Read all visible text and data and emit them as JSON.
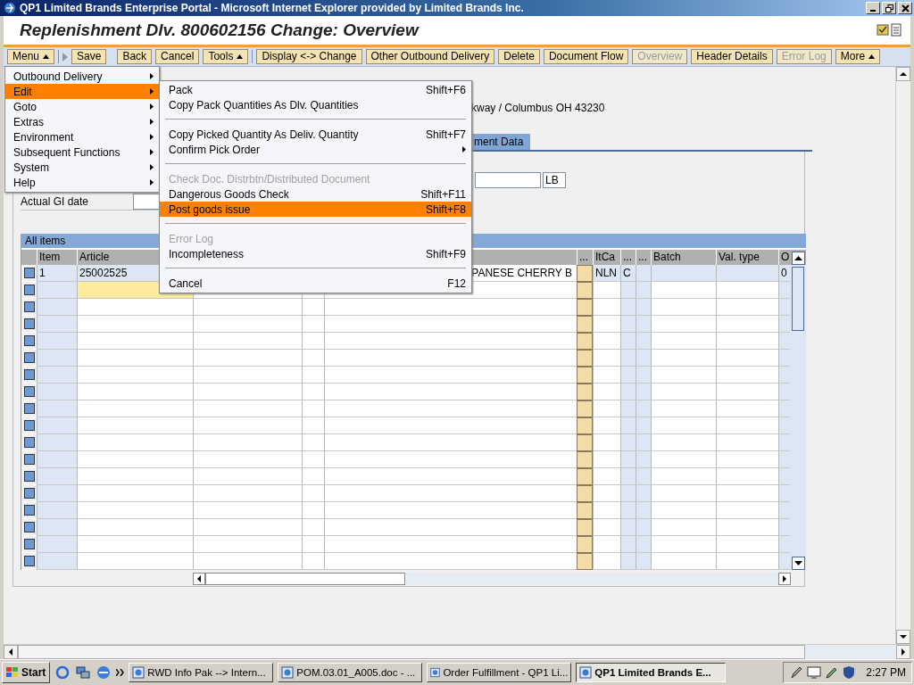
{
  "window": {
    "title": "QP1 Limited Brands Enterprise Portal - Microsoft Internet Explorer provided by Limited Brands Inc."
  },
  "page_title": "Replenishment Dlv. 800602156 Change: Overview",
  "toolbar": [
    {
      "label": "Menu",
      "kind": "dropdown",
      "disabled": false
    },
    {
      "kind": "expander"
    },
    {
      "label": "Save",
      "kind": "button",
      "disabled": false
    },
    {
      "kind": "gap"
    },
    {
      "label": "Back",
      "kind": "button",
      "disabled": false
    },
    {
      "label": "Cancel",
      "kind": "button",
      "disabled": false
    },
    {
      "label": "Tools",
      "kind": "dropdown",
      "disabled": false
    },
    {
      "kind": "separator"
    },
    {
      "label": "Display <-> Change",
      "kind": "button",
      "disabled": false
    },
    {
      "label": "Other Outbound Delivery",
      "kind": "button",
      "disabled": false
    },
    {
      "label": "Delete",
      "kind": "button",
      "disabled": false
    },
    {
      "label": "Document Flow",
      "kind": "button",
      "disabled": false
    },
    {
      "label": "Overview",
      "kind": "button",
      "disabled": true
    },
    {
      "label": "Header Details",
      "kind": "button",
      "disabled": false
    },
    {
      "label": "Error Log",
      "kind": "button",
      "disabled": true
    },
    {
      "label": "More",
      "kind": "dropdown",
      "disabled": false
    }
  ],
  "menu": {
    "items": [
      {
        "label": "Outbound Delivery",
        "selected": false
      },
      {
        "label": "Edit",
        "selected": true
      },
      {
        "label": "Goto",
        "selected": false
      },
      {
        "label": "Extras",
        "selected": false
      },
      {
        "label": "Environment",
        "selected": false
      },
      {
        "label": "Subsequent Functions",
        "selected": false
      },
      {
        "label": "System",
        "selected": false
      },
      {
        "label": "Help",
        "selected": false
      }
    ]
  },
  "submenu": {
    "items": [
      {
        "kind": "item",
        "label": "Pack",
        "shortcut": "Shift+F6",
        "disabled": false,
        "selected": false,
        "has_submenu": false
      },
      {
        "kind": "item",
        "label": "Copy Pack Quantities As Dlv. Quantities",
        "disabled": false,
        "selected": false,
        "has_submenu": false
      },
      {
        "kind": "separator"
      },
      {
        "kind": "item",
        "label": "Copy Picked Quantity As Deliv. Quantity",
        "shortcut": "Shift+F7",
        "disabled": false,
        "selected": false,
        "has_submenu": false
      },
      {
        "kind": "item",
        "label": "Confirm Pick Order",
        "disabled": false,
        "selected": false,
        "has_submenu": true
      },
      {
        "kind": "separator"
      },
      {
        "kind": "item",
        "label": "Check Doc. Distrbtn/Distributed Document",
        "disabled": true,
        "selected": false,
        "has_submenu": false
      },
      {
        "kind": "item",
        "label": "Dangerous Goods Check",
        "shortcut": "Shift+F11",
        "disabled": false,
        "selected": false,
        "has_submenu": false
      },
      {
        "kind": "item",
        "label": "Post goods issue",
        "shortcut": "Shift+F8",
        "disabled": false,
        "selected": true,
        "has_submenu": false
      },
      {
        "kind": "separator"
      },
      {
        "kind": "item",
        "label": "Error Log",
        "disabled": true,
        "selected": false,
        "has_submenu": false
      },
      {
        "kind": "item",
        "label": "Incompleteness",
        "shortcut": "Shift+F9",
        "disabled": false,
        "selected": false,
        "has_submenu": false
      },
      {
        "kind": "separator"
      },
      {
        "kind": "item",
        "label": "Cancel",
        "shortcut": "F12",
        "disabled": false,
        "selected": false,
        "has_submenu": false
      }
    ]
  },
  "header": {
    "address": "kway / Columbus OH 43230",
    "tab": "ment Data",
    "unit": "LB",
    "gi_date_label": "Actual GI date"
  },
  "table": {
    "title": "All items",
    "columns": [
      "Item",
      "Article",
      "...",
      "ItCa",
      "...",
      "...",
      "Batch",
      "Val. type",
      "O"
    ],
    "rows": [
      {
        "item": "1",
        "article": "25002525",
        "description": "PANESE CHERRY B",
        "itca": "NLN",
        "column_8": "C",
        "o": "0"
      }
    ]
  },
  "taskbar": {
    "start": "Start",
    "tasks": [
      {
        "label": "RWD Info Pak --> Intern...",
        "selected": false
      },
      {
        "label": "POM.03.01_A005.doc - ...",
        "selected": false
      },
      {
        "label": "Order Fulfillment - QP1 Li...",
        "selected": false
      },
      {
        "label": "QP1 Limited Brands E...",
        "selected": true
      }
    ],
    "clock": "2:27 PM"
  }
}
